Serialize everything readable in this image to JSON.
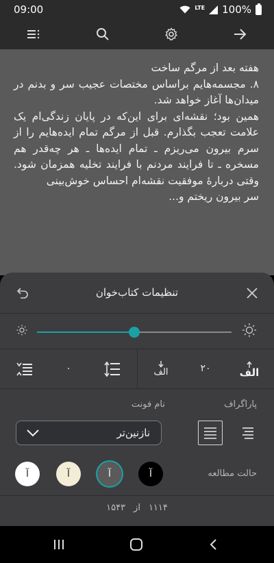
{
  "status": {
    "time": "09:00",
    "network": "LTE",
    "battery": "100%"
  },
  "reader": {
    "lines": [
      "هفته بعد از مرگم ساخت",
      "۸. مجسمه‌هایم براساس مختصات عجیب سر و بدنم در میدان‌ها آغاز خواهد شد.",
      "همین بود؛ نقشه‌ای برای این‌که در پایان زندگی‌ام یک علامت تعجب بگذارم. قبل از مرگم تمام ایده‌هایم را از سرم بیرون می‌ریزم ـ تمام ایده‌ها ـ هر چه‌قدر هم مسخره ـ تا فرایند مردنم با فرایند تخلیه همزمان شود. وقتی دربارهٔ موفقیت نقشه‌ام احساس خوش‌بینی",
      "سر بیرون ریختم و..."
    ]
  },
  "settings": {
    "title": "تنظیمات کتاب‌خوان",
    "brightness": 0.5,
    "font_size_value": "۲۰",
    "line_spacing_value": "۰",
    "alef": "الف",
    "font_name_label": "نام فونت",
    "paragraph_label": "پاراگراف",
    "font_selected": "نازنین‌تر",
    "reading_mode_label": "حالت مطالعه",
    "theme_glyph": "آ",
    "themes": [
      {
        "name": "white",
        "bg": "#ffffff",
        "fg": "#222222"
      },
      {
        "name": "sepia",
        "bg": "#f3ecd6",
        "fg": "#222222"
      },
      {
        "name": "gray",
        "bg": "#5a5a5a",
        "fg": "#ffffff"
      },
      {
        "name": "black",
        "bg": "#000000",
        "fg": "#ffffff"
      }
    ],
    "selected_theme": "gray",
    "accent": "#1aa1a6",
    "page_current": "۱۱۱۴",
    "page_of": "از",
    "page_total": "۱۵۴۳"
  }
}
